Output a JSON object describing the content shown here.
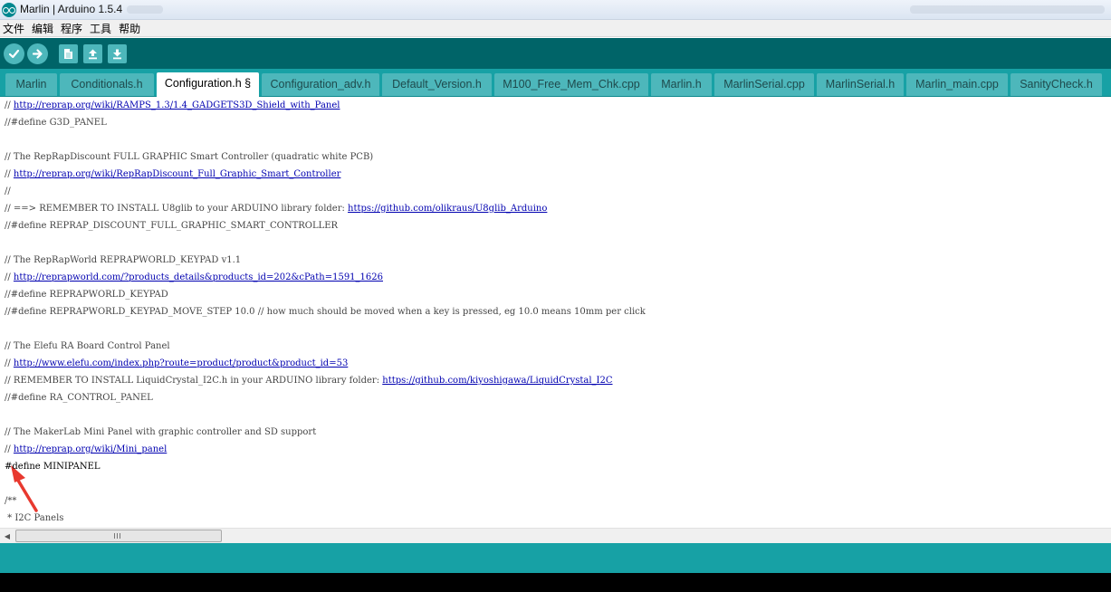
{
  "window": {
    "title": "Marlin | Arduino 1.5.4"
  },
  "menu": [
    "文件",
    "编辑",
    "程序",
    "工具",
    "帮助"
  ],
  "toolbar": {
    "verify": "verify-icon",
    "upload": "upload-arrow-icon",
    "new": "new-file-icon",
    "open": "open-icon",
    "save": "save-icon"
  },
  "tabs": [
    {
      "label": "Marlin"
    },
    {
      "label": "Conditionals.h"
    },
    {
      "label": "Configuration.h §",
      "active": true
    },
    {
      "label": "Configuration_adv.h"
    },
    {
      "label": "Default_Version.h"
    },
    {
      "label": "M100_Free_Mem_Chk.cpp"
    },
    {
      "label": "Marlin.h"
    },
    {
      "label": "MarlinSerial.cpp"
    },
    {
      "label": "MarlinSerial.h"
    },
    {
      "label": "Marlin_main.cpp"
    },
    {
      "label": "SanityCheck.h"
    }
  ],
  "code": [
    {
      "prefix": "// ",
      "link": "http://reprap.org/wiki/RAMPS_1.3/1.4_GADGETS3D_Shield_with_Panel"
    },
    {
      "text": "//#define G3D_PANEL"
    },
    {
      "text": ""
    },
    {
      "text": "// The RepRapDiscount FULL GRAPHIC Smart Controller (quadratic white PCB)"
    },
    {
      "prefix": "// ",
      "link": "http://reprap.org/wiki/RepRapDiscount_Full_Graphic_Smart_Controller"
    },
    {
      "text": "//"
    },
    {
      "prefix": "// ==> REMEMBER TO INSTALL U8glib to your ARDUINO library folder: ",
      "link": "https://github.com/olikraus/U8glib_Arduino"
    },
    {
      "text": "//#define REPRAP_DISCOUNT_FULL_GRAPHIC_SMART_CONTROLLER"
    },
    {
      "text": ""
    },
    {
      "text": "// The RepRapWorld REPRAPWORLD_KEYPAD v1.1"
    },
    {
      "prefix": "// ",
      "link": "http://reprapworld.com/?products_details&products_id=202&cPath=1591_1626"
    },
    {
      "text": "//#define REPRAPWORLD_KEYPAD"
    },
    {
      "text": "//#define REPRAPWORLD_KEYPAD_MOVE_STEP 10.0 // how much should be moved when a key is pressed, eg 10.0 means 10mm per click"
    },
    {
      "text": ""
    },
    {
      "text": "// The Elefu RA Board Control Panel"
    },
    {
      "prefix": "// ",
      "link": "http://www.elefu.com/index.php?route=product/product&product_id=53"
    },
    {
      "prefix": "// REMEMBER TO INSTALL LiquidCrystal_I2C.h in your ARDUINO library folder: ",
      "link": "https://github.com/kiyoshigawa/LiquidCrystal_I2C"
    },
    {
      "text": "//#define RA_CONTROL_PANEL"
    },
    {
      "text": ""
    },
    {
      "text": "// The MakerLab Mini Panel with graphic controller and SD support"
    },
    {
      "prefix": "// ",
      "link": "http://reprap.org/wiki/Mini_panel"
    },
    {
      "text": "#define MINIPANEL",
      "code": true
    },
    {
      "text": ""
    },
    {
      "text": "/**"
    },
    {
      "text": " * I2C Panels"
    }
  ],
  "scrollbar": {
    "left_arrow": "◀"
  },
  "colors": {
    "toolbar": "#006468",
    "tabstrip": "#17a1a5",
    "tab": "#4db7bb",
    "link": "#0000b0",
    "annotation_arrow": "#e8392f"
  }
}
